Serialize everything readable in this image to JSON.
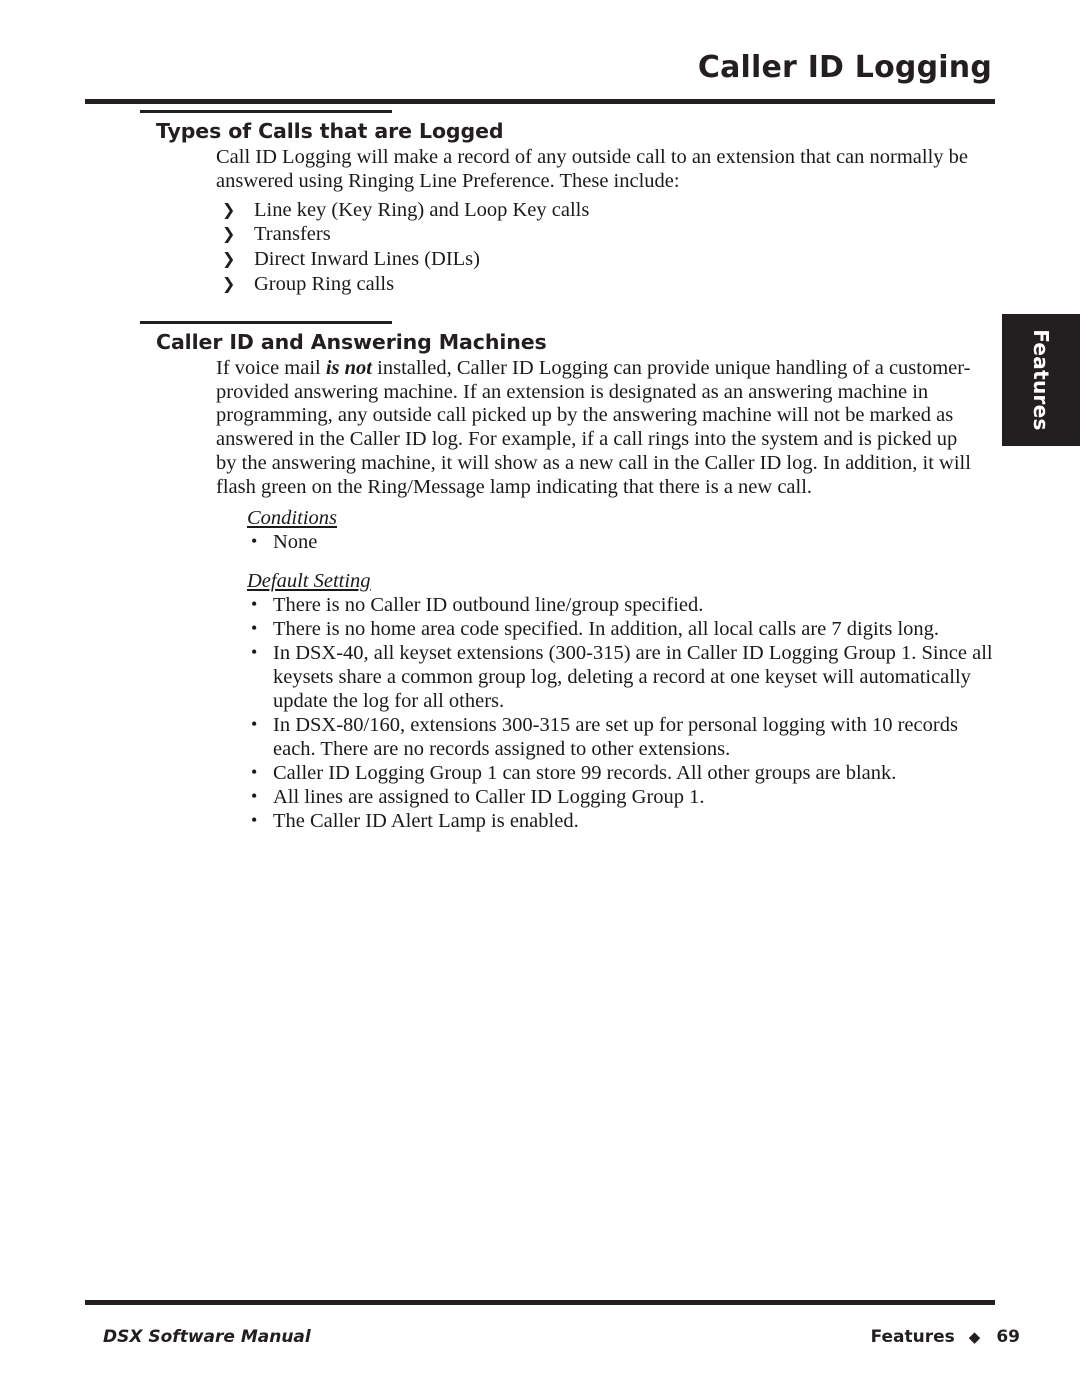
{
  "header": {
    "title": "Caller ID Logging"
  },
  "side_tab": {
    "label": "Features"
  },
  "sections": [
    {
      "heading": "Types of Calls that are Logged",
      "paragraph": "Call ID Logging will make a record of any outside call to an extension that can normally be answered using Ringing Line Preference. These include:",
      "bullet_glyph": "❯",
      "bullets": [
        "Line key (Key Ring) and Loop Key calls",
        "Transfers",
        "Direct Inward Lines (DILs)",
        "Group Ring calls"
      ]
    },
    {
      "heading": "Caller ID and Answering Machines",
      "paragraph_part1": "If voice mail ",
      "paragraph_emphasis": "is not",
      "paragraph_part2": " installed, Caller ID Logging can provide unique handling of a customer-provided answering machine. If an extension is designated as an answering machine in programming, any outside call picked up by the answering machine will not be marked as answered in the Caller ID log. For example, if a call rings into the system and is picked up by the answering machine, it will show as a new call in the Caller ID log. In addition, it will flash green on the Ring/Message lamp indicating that there is a new call.",
      "conditions_heading": "Conditions",
      "conditions": [
        "None"
      ],
      "default_setting_heading": "Default Setting",
      "dot_glyph": "•",
      "default_settings": [
        "There is no Caller ID outbound line/group specified.",
        "There is no home area code specified. In addition, all local calls are 7 digits long.",
        "In DSX-40, all keyset extensions (300-315) are in Caller ID Logging Group 1. Since all keysets share a common group log, deleting a record at one keyset will automatically update the log for all others.",
        "In DSX-80/160, extensions 300-315 are set up for personal logging with 10 records each. There are no records assigned to other extensions.",
        "Caller ID Logging Group 1 can store 99 records. All other groups are blank.",
        "All lines are assigned to Caller ID Logging Group 1.",
        "The Caller ID Alert Lamp is enabled."
      ]
    }
  ],
  "footer": {
    "manual_title": "DSX Software Manual",
    "chapter": "Features",
    "diamond": "◆",
    "page_number": "69"
  },
  "colors": {
    "ink": "#231f20",
    "tab_background": "#231f20",
    "tab_text": "#ffffff",
    "page_background": "#ffffff"
  }
}
